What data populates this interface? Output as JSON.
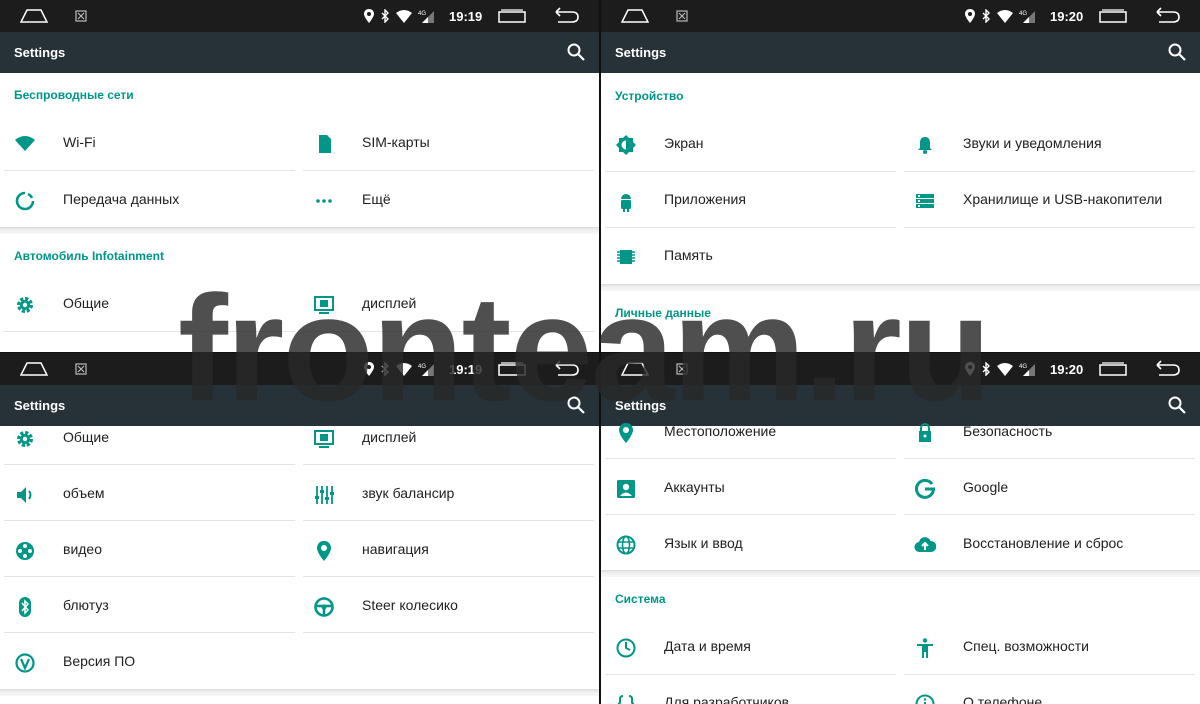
{
  "watermark": "fronteam.ru",
  "accent_color": "#009688",
  "panels": {
    "top_left": {
      "time": "19:19",
      "title": "Settings",
      "sections": {
        "wireless": "Беспроводные сети",
        "auto": "Автомобиль Infotainment"
      },
      "items": {
        "wifi": "Wi-Fi",
        "sim": "SIM-карты",
        "data": "Передача данных",
        "more": "Ещё",
        "general": "Общие",
        "display": "дисплей"
      }
    },
    "top_right": {
      "time": "19:20",
      "title": "Settings",
      "sections": {
        "device": "Устройство",
        "personal": "Личные данные"
      },
      "items": {
        "screen": "Экран",
        "sounds": "Звуки и уведомления",
        "apps": "Приложения",
        "storage": "Хранилище и USB-накопители",
        "memory": "Память"
      }
    },
    "bottom_left": {
      "time": "19:19",
      "title": "Settings",
      "items": {
        "general": "Общие",
        "display": "дисплей",
        "volume": "объем",
        "balance": "звук балансир",
        "video": "видео",
        "navigation": "навигация",
        "bluetooth": "блютуз",
        "steer": "Steer колесико",
        "version": "Версия ПО"
      }
    },
    "bottom_right": {
      "time": "19:20",
      "title": "Settings",
      "sections": {
        "system": "Система"
      },
      "items": {
        "location": "Местоположение",
        "security": "Безопасность",
        "accounts": "Аккаунты",
        "google": "Google",
        "language": "Язык и ввод",
        "backup": "Восстановление и сброс",
        "datetime": "Дата и время",
        "accessibility": "Спец. возможности",
        "developer": "Для разработчиков",
        "about": "О телефоне"
      }
    }
  },
  "icons": {
    "status": [
      "location-icon",
      "bluetooth-icon",
      "wifi-signal-icon",
      "network-4g-icon"
    ],
    "nav": [
      "home-icon",
      "recent-apps-icon",
      "back-icon"
    ]
  }
}
